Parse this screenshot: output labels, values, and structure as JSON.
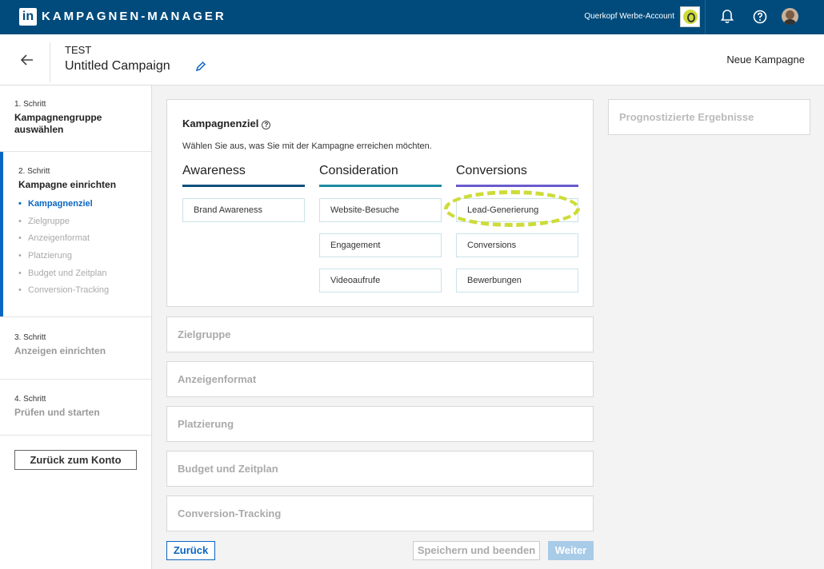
{
  "topbar": {
    "logo_text": "in",
    "app_title": "KAMPAGNEN-MANAGER",
    "account_name": "Querkopf Werbe-Account",
    "icons": [
      "account-logo-icon",
      "bell-icon",
      "help-icon",
      "avatar"
    ]
  },
  "header": {
    "campaign_group": "TEST",
    "campaign_name": "Untitled Campaign",
    "new_campaign_label": "Neue Kampagne"
  },
  "sidebar": {
    "steps": [
      {
        "number": "1. Schritt",
        "title": "Kampagnengruppe auswählen"
      },
      {
        "number": "2. Schritt",
        "title": "Kampagne einrichten",
        "substeps": [
          "Kampagnenziel",
          "Zielgruppe",
          "Anzeigenformat",
          "Platzierung",
          "Budget und Zeitplan",
          "Conversion-Tracking"
        ]
      },
      {
        "number": "3. Schritt",
        "title": "Anzeigen einrichten"
      },
      {
        "number": "4. Schritt",
        "title": "Prüfen und starten"
      }
    ],
    "back_to_account": "Zurück zum Konto"
  },
  "objective": {
    "title": "Kampagnenziel",
    "help_glyph": "?",
    "description": "Wählen Sie aus, was Sie mit der Kampagne erreichen möchten.",
    "columns": [
      {
        "heading": "Awareness",
        "color": "#0d4f7c",
        "options": [
          "Brand Awareness"
        ]
      },
      {
        "heading": "Consideration",
        "color": "#1e8ba1",
        "options": [
          "Website-Besuche",
          "Engagement",
          "Videoaufrufe"
        ]
      },
      {
        "heading": "Conversions",
        "color": "#6a5acd",
        "options": [
          "Lead-Generierung",
          "Conversions",
          "Bewerbungen"
        ]
      }
    ],
    "highlight_color": "#cddc39"
  },
  "sections": [
    "Zielgruppe",
    "Anzeigenformat",
    "Platzierung",
    "Budget und Zeitplan",
    "Conversion-Tracking"
  ],
  "forecast_title": "Prognostizierte Ergebnisse",
  "footer": {
    "back": "Zurück",
    "save_exit": "Speichern und beenden",
    "next": "Weiter"
  }
}
